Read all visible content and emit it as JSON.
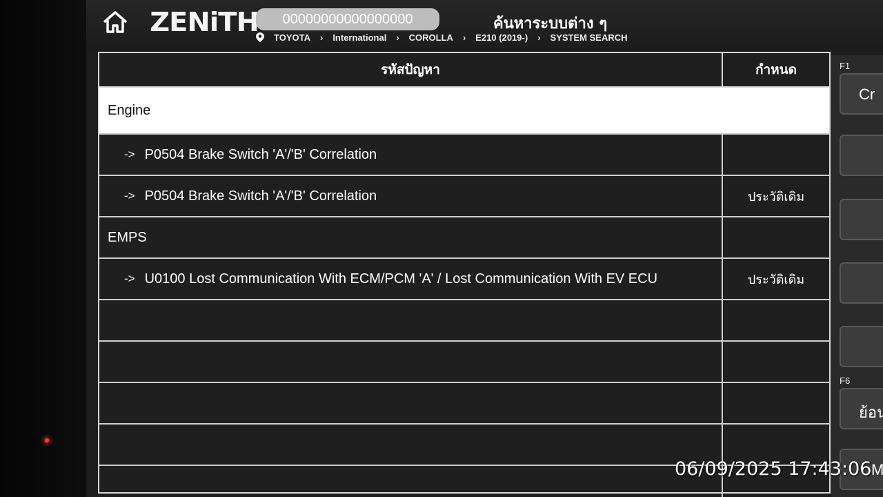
{
  "header": {
    "logo": "ZENiTH",
    "vin": "00000000000000000",
    "title": "ค้นหาระบบต่าง ๆ",
    "breadcrumb": [
      "TOYOTA",
      "International",
      "COROLLA",
      "E210 (2019-)",
      "SYSTEM SEARCH"
    ]
  },
  "table": {
    "headers": {
      "code": "รหัสปัญหา",
      "status": "กำหนด"
    },
    "rows": [
      {
        "type": "group",
        "code": "Engine",
        "status": ""
      },
      {
        "type": "dtc",
        "code": "P0504 Brake Switch 'A'/'B' Correlation",
        "status": ""
      },
      {
        "type": "dtc",
        "code": "P0504 Brake Switch 'A'/'B' Correlation",
        "status": "ประวัติเดิม"
      },
      {
        "type": "group",
        "code": "EMPS",
        "status": ""
      },
      {
        "type": "dtc",
        "code": "U0100 Lost Communication With ECM/PCM 'A' / Lost Communication With EV ECU",
        "status": "ประวัติเดิม"
      },
      {
        "type": "empty",
        "code": "",
        "status": ""
      },
      {
        "type": "empty",
        "code": "",
        "status": ""
      },
      {
        "type": "empty",
        "code": "",
        "status": ""
      },
      {
        "type": "empty",
        "code": "",
        "status": ""
      },
      {
        "type": "empty",
        "code": "",
        "status": ""
      }
    ],
    "arrow_glyph": "->"
  },
  "fkeys": {
    "f1": {
      "num": "F1",
      "label": "Cr"
    },
    "f6": {
      "num": "F6",
      "label": "ย้อน"
    },
    "f7": {
      "label": "Mo"
    }
  },
  "timestamp": "06/09/2025 17:43:06",
  "icons": {
    "home": "home-icon",
    "location": "location-pin-icon",
    "chevron": "chevron-right-icon"
  }
}
